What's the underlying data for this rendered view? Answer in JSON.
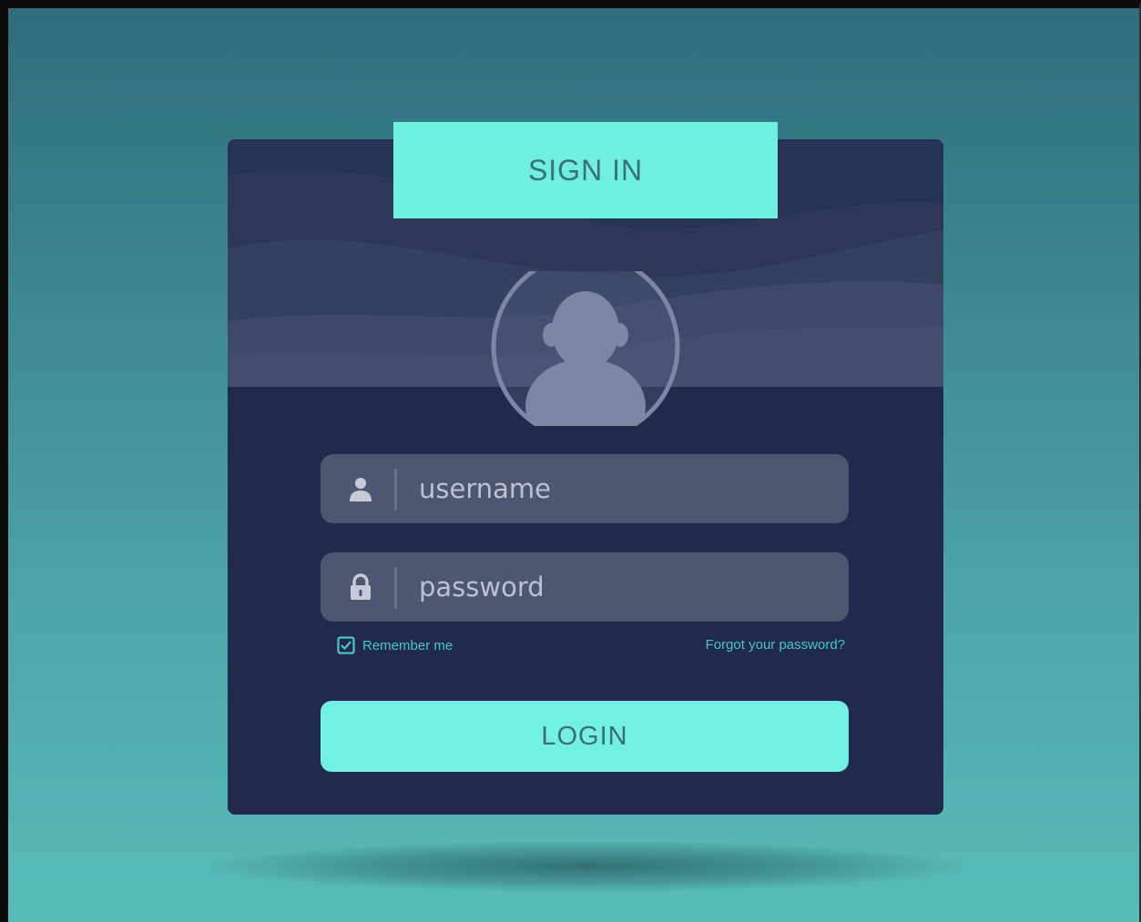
{
  "title": "SIGN IN",
  "form": {
    "username_placeholder": "username",
    "password_placeholder": "password",
    "remember_label": "Remember me",
    "remember_checked": true,
    "forgot_label": "Forgot your password?",
    "login_label": "LOGIN"
  },
  "icons": {
    "avatar": "user-avatar-icon",
    "username": "user-icon",
    "password": "lock-icon",
    "remember": "checkbox-icon"
  },
  "colors": {
    "background_top": "#2f6d7c",
    "background_bottom": "#58bcb8",
    "card": "#1f2a4c",
    "accent": "#6fefe0",
    "field": "#4e5771",
    "link": "#47c8c0"
  }
}
